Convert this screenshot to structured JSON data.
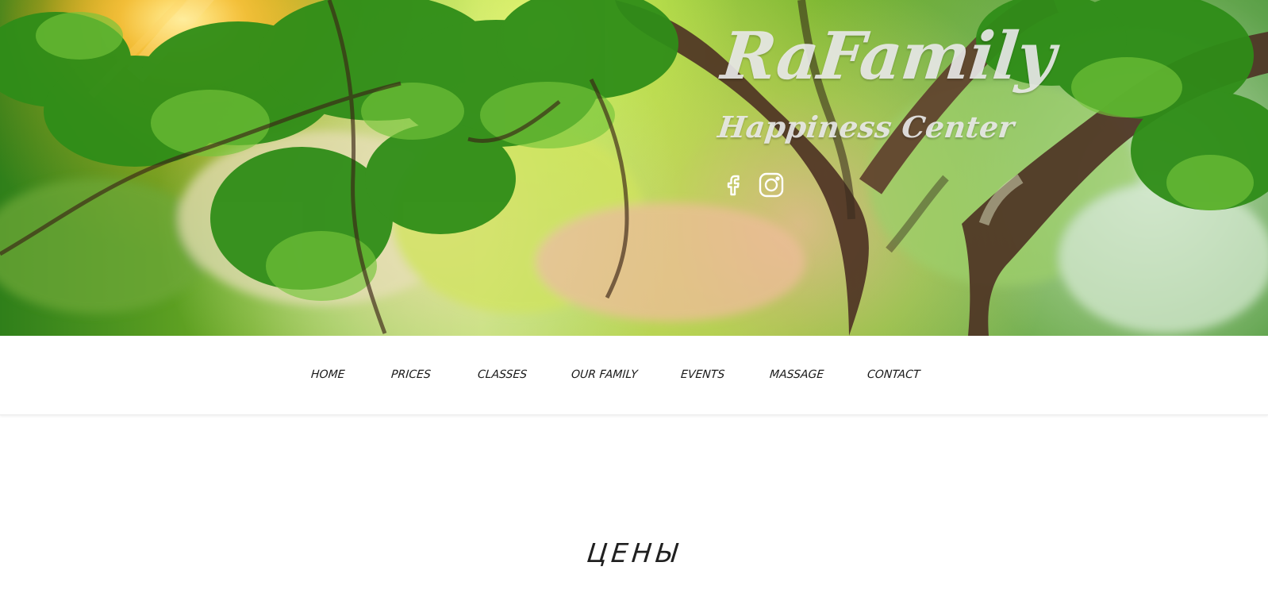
{
  "brand": {
    "title": "RaFamily",
    "subtitle": "Happiness Center"
  },
  "social": [
    {
      "name": "facebook",
      "icon": "facebook-icon"
    },
    {
      "name": "instagram",
      "icon": "instagram-icon"
    }
  ],
  "navigation": {
    "items": [
      "HOME",
      "PRICES",
      "CLASSES",
      "OUR FAMILY",
      "EVENTS",
      "MASSAGE",
      "CONTACT"
    ]
  },
  "main": {
    "section_heading": "ЦЕНЫ"
  },
  "colors": {
    "text": "#1b1b1b",
    "nav_background": "#ffffff",
    "logo": "#ebebeb"
  }
}
